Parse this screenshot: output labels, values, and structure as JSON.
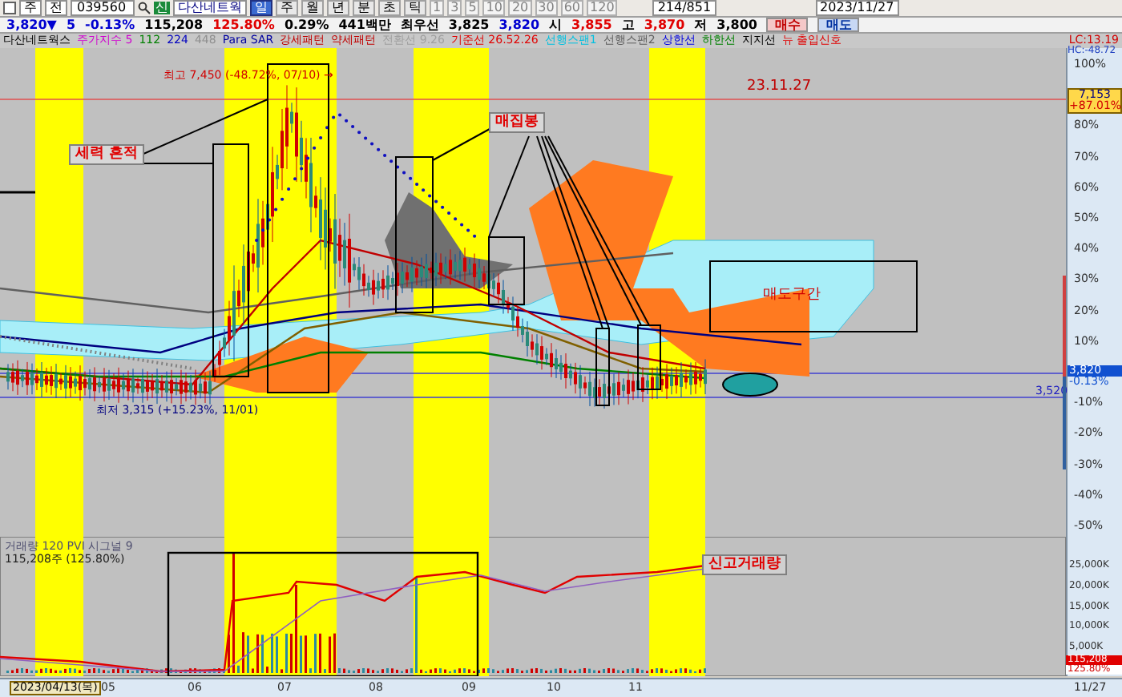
{
  "toolbar": {
    "market": "주",
    "market2": "전",
    "code": "039560",
    "search_badge": "신",
    "name": "다산네트웍",
    "periods": [
      {
        "label": "일",
        "selected": true
      },
      {
        "label": "주",
        "selected": false
      },
      {
        "label": "월",
        "selected": false
      },
      {
        "label": "년",
        "selected": false
      },
      {
        "label": "분",
        "selected": false
      },
      {
        "label": "초",
        "selected": false
      },
      {
        "label": "틱",
        "selected": false
      }
    ],
    "intervals": [
      "1",
      "3",
      "5",
      "10",
      "20",
      "30",
      "60",
      "120"
    ],
    "page": "214/851",
    "date": "2023/11/27"
  },
  "quote": [
    {
      "text": "3,820▼",
      "color": "#0000d0"
    },
    {
      "text": "5",
      "color": "#0000d0"
    },
    {
      "text": "-0.13%",
      "color": "#0000d0"
    },
    {
      "text": "115,208",
      "color": "#000000"
    },
    {
      "text": "125.80%",
      "color": "#e00000"
    },
    {
      "text": "0.29%",
      "color": "#000000"
    },
    {
      "text": "441백만",
      "color": "#000000"
    },
    {
      "text": "최우선",
      "color": "#000000"
    },
    {
      "text": "3,825",
      "color": "#000000"
    },
    {
      "text": "3,820",
      "color": "#0000d0"
    },
    {
      "text": "시",
      "color": "#000000"
    },
    {
      "text": "3,855",
      "color": "#e00000"
    },
    {
      "text": "고",
      "color": "#000000"
    },
    {
      "text": "3,870",
      "color": "#e00000"
    },
    {
      "text": "저",
      "color": "#000000"
    },
    {
      "text": "3,800",
      "color": "#000000"
    }
  ],
  "order_buttons": [
    {
      "label": "매수",
      "kind": "buy"
    },
    {
      "label": "매도",
      "kind": "sell"
    }
  ],
  "legend": [
    {
      "label": "다산네트웍스",
      "color": "#000000"
    },
    {
      "label": "주가지수 5",
      "color": "#d000d0"
    },
    {
      "label": "112",
      "color": "#008000"
    },
    {
      "label": "224",
      "color": "#0000c0"
    },
    {
      "label": "448",
      "color": "#909090"
    },
    {
      "label": "Para SAR",
      "color": "#0000a0"
    },
    {
      "label": "강세패턴",
      "color": "#c00000"
    },
    {
      "label": "약세패턴",
      "color": "#c00000"
    },
    {
      "label": "전환선 9.26",
      "color": "#a0a0a0"
    },
    {
      "label": "기준선 26.52.26",
      "color": "#e00000"
    },
    {
      "label": "선행스팬1",
      "color": "#00c0e0"
    },
    {
      "label": "선행스팬2",
      "color": "#606060"
    },
    {
      "label": "상한선",
      "color": "#0000e0"
    },
    {
      "label": "하한선",
      "color": "#008000"
    },
    {
      "label": "지지선",
      "color": "#000000"
    },
    {
      "label": "뉴 출입신호",
      "color": "#e00000"
    }
  ],
  "price_panel": {
    "high_note": "최고 7,450 (-48.72%, 07/10) →",
    "low_note": "최저 3,315 (+15.23%, 11/01)",
    "date_note": "23.11.27",
    "labels": [
      "세력 흔적",
      "매집봉",
      "매도구간"
    ],
    "lc": "LC:13.19",
    "hc": "HC:-48.72",
    "axis": [
      "100%",
      "80%",
      "70%",
      "60%",
      "50%",
      "40%",
      "30%",
      "20%",
      "10%",
      "-10%",
      "-20%",
      "-30%",
      "-40%",
      "-50%"
    ],
    "tag_high": {
      "price": "7,153",
      "pct": "+87.01%"
    },
    "tag_last": {
      "price": "3,820",
      "pct": "-0.13%"
    },
    "support": "3,520"
  },
  "volume_panel": {
    "legend": "거래량 120 PVI 시그널 9",
    "reading": "115,208주 (125.80%)",
    "label": "신고거래량",
    "axis": [
      "25,000K",
      "20,000K",
      "15,000K",
      "10,000K",
      "5,000K"
    ],
    "tag": {
      "value": "115,208",
      "pct": "125.80%"
    }
  },
  "date_axis": {
    "start": "2023/04/13(목)",
    "months": [
      "05",
      "06",
      "07",
      "08",
      "09",
      "10",
      "11"
    ],
    "end": "11/27"
  }
}
